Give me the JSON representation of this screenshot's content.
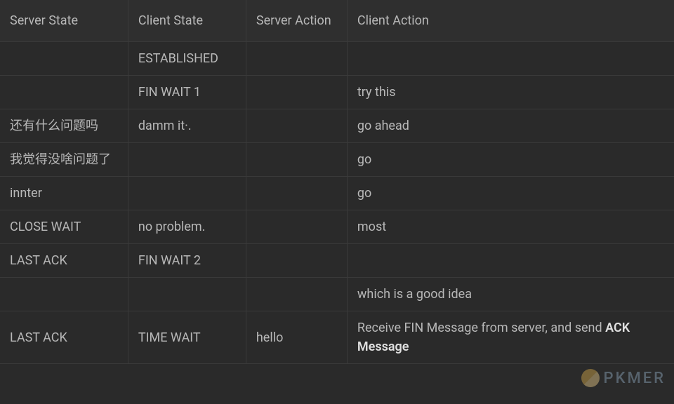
{
  "table": {
    "headers": [
      "Server State",
      "Client State",
      "Server Action",
      "Client Action"
    ],
    "rows": [
      [
        "",
        "ESTABLISHED",
        "",
        ""
      ],
      [
        "",
        "FIN WAIT 1",
        "",
        "try this"
      ],
      [
        "还有什么问题吗",
        "damm it·.",
        "",
        "go ahead"
      ],
      [
        "我觉得没啥问题了",
        "",
        "",
        "go"
      ],
      [
        "innter",
        "",
        "",
        "go"
      ],
      [
        "CLOSE WAIT",
        "no problem.",
        "",
        "most"
      ],
      [
        "LAST ACK",
        "FIN WAIT 2",
        "",
        ""
      ],
      [
        "",
        "",
        "",
        "which is a good idea"
      ],
      [
        "LAST ACK",
        "TIME WAIT",
        "hello",
        "Receive FIN Message from server, and send <b>ACK Message</b>"
      ]
    ]
  },
  "watermark": {
    "text": "PKMER"
  }
}
